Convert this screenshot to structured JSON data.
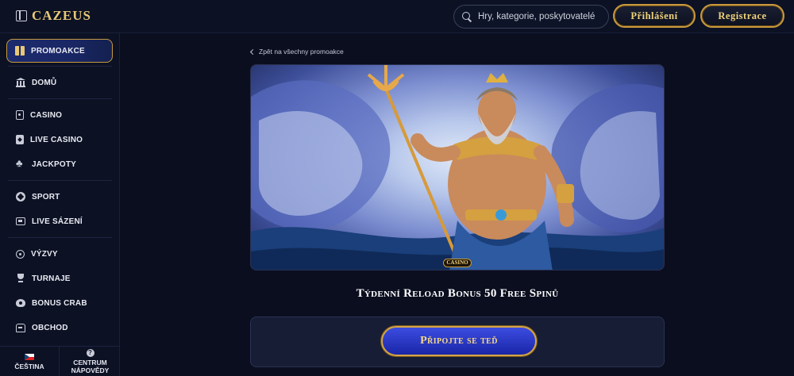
{
  "header": {
    "logo": "CAZEUS",
    "search_placeholder": "Hry, kategorie, poskytovatelé",
    "login_label": "Přihlášení",
    "register_label": "Registrace"
  },
  "sidebar": {
    "items": [
      {
        "label": "PROMOAKCE",
        "icon": "gift-icon"
      },
      {
        "label": "DOMŮ",
        "icon": "bank-icon"
      },
      {
        "label": "CASINO",
        "icon": "slot-cards-icon"
      },
      {
        "label": "LIVE CASINO",
        "icon": "card-icon"
      },
      {
        "label": "JACKPOTY",
        "icon": "clover-icon"
      },
      {
        "label": "SPORT",
        "icon": "soccer-ball-icon"
      },
      {
        "label": "LIVE SÁZENÍ",
        "icon": "live-tv-icon"
      },
      {
        "label": "VÝZVY",
        "icon": "medal-icon"
      },
      {
        "label": "TURNAJE",
        "icon": "trophy-icon"
      },
      {
        "label": "BONUS CRAB",
        "icon": "crab-icon"
      },
      {
        "label": "OBCHOD",
        "icon": "shop-icon"
      }
    ],
    "footer": {
      "language_label": "ČEŠTINA",
      "help_label_1": "CENTRUM",
      "help_label_2": "NÁPOVĚDY",
      "help_glyph": "?"
    }
  },
  "main": {
    "back_link": "Zpět na všechny promoakce",
    "banner_badge": "CASINO",
    "promo_title": "Týdenní Reload Bonus 50 Free Spinů",
    "cta_label": "Připojte se teď"
  },
  "colors": {
    "background": "#0a0e1f",
    "gold": "#c89a3d",
    "gold_text": "#f0d27a",
    "cta_blue": "#2a3ac8"
  }
}
